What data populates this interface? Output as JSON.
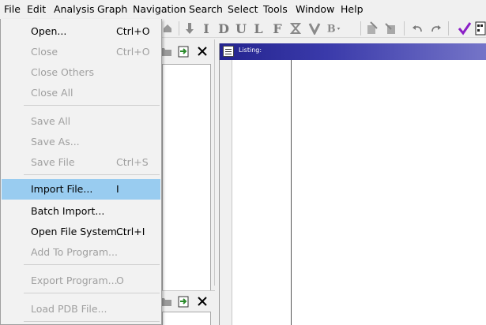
{
  "menubar": {
    "items": [
      {
        "label": "File"
      },
      {
        "label": "Edit"
      },
      {
        "label": "Analysis"
      },
      {
        "label": "Graph"
      },
      {
        "label": "Navigation"
      },
      {
        "label": "Search"
      },
      {
        "label": "Select"
      },
      {
        "label": "Tools"
      },
      {
        "label": "Window"
      },
      {
        "label": "Help"
      }
    ]
  },
  "toolbar": {
    "letters": [
      "I",
      "D",
      "U",
      "L",
      "F"
    ],
    "icons": [
      "arrow-down-icon",
      "bold-letter-icons",
      "undo-icon",
      "redo-icon",
      "checkmark-icon"
    ],
    "accent_check": "#8b1fc7"
  },
  "file_menu": {
    "items": [
      {
        "label": "Open...",
        "shortcut": "Ctrl+O",
        "enabled": true
      },
      {
        "label": "Close",
        "shortcut": "Ctrl+O",
        "enabled": false
      },
      {
        "label": "Close Others",
        "shortcut": "",
        "enabled": false
      },
      {
        "label": "Close All",
        "shortcut": "",
        "enabled": false
      },
      {
        "label": "Save All",
        "shortcut": "",
        "enabled": false
      },
      {
        "label": "Save As...",
        "shortcut": "",
        "enabled": false
      },
      {
        "label": "Save File",
        "shortcut": "Ctrl+S",
        "enabled": false
      },
      {
        "label": "Import File...",
        "shortcut": "I",
        "enabled": true,
        "highlighted": true
      },
      {
        "label": "Batch Import...",
        "shortcut": "",
        "enabled": true
      },
      {
        "label": "Open File System...",
        "shortcut": "Ctrl+I",
        "enabled": true
      },
      {
        "label": "Add To Program...",
        "shortcut": "",
        "enabled": false
      },
      {
        "label": "Export Program...",
        "shortcut": "O",
        "enabled": false
      },
      {
        "label": "Load PDB File...",
        "shortcut": "",
        "enabled": false
      }
    ]
  },
  "listing": {
    "title": "Listing:"
  },
  "colors": {
    "highlight": "#99ccf0",
    "titlebar": "#2a2a95"
  }
}
